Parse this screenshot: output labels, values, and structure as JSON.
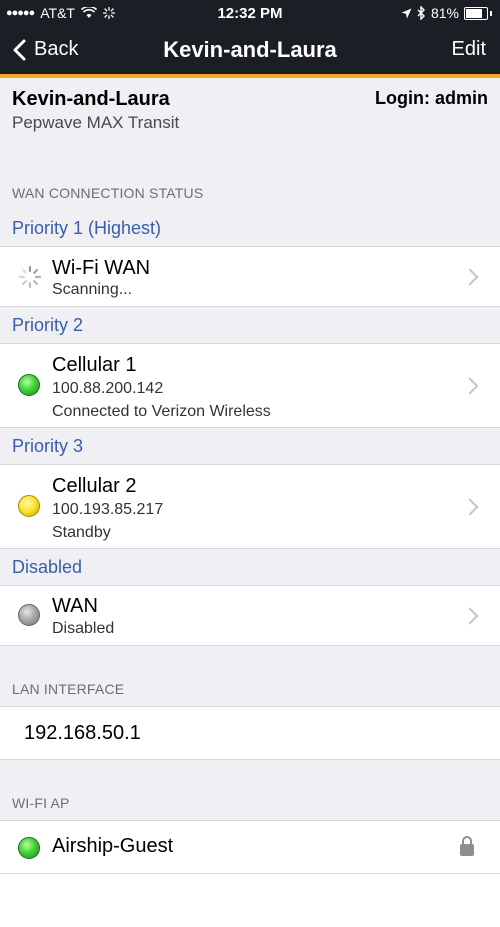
{
  "status_bar": {
    "carrier": "AT&T",
    "time": "12:32 PM",
    "battery": "81%",
    "battery_level": 0.81
  },
  "nav": {
    "back_label": "Back",
    "title": "Kevin-and-Laura",
    "edit_label": "Edit"
  },
  "device": {
    "name": "Kevin-and-Laura",
    "model": "Pepwave MAX Transit",
    "login": "Login: admin"
  },
  "wan": {
    "section_title": "WAN CONNECTION STATUS",
    "groups": [
      {
        "priority": "Priority 1 (Highest)",
        "name": "Wi-Fi WAN",
        "lines": [
          "Scanning..."
        ],
        "status_icon": "spinner-icon"
      },
      {
        "priority": "Priority 2",
        "name": "Cellular 1",
        "lines": [
          "100.88.200.142",
          "Connected to Verizon Wireless"
        ],
        "status_icon": "green-led"
      },
      {
        "priority": "Priority 3",
        "name": "Cellular 2",
        "lines": [
          "100.193.85.217",
          "Standby"
        ],
        "status_icon": "yellow-led"
      },
      {
        "priority": "Disabled",
        "name": "WAN",
        "lines": [
          "Disabled"
        ],
        "status_icon": "gray-led"
      }
    ]
  },
  "lan": {
    "section_title": "LAN INTERFACE",
    "ip": "192.168.50.1"
  },
  "wifi_ap": {
    "section_title": "WI-FI AP",
    "networks": [
      {
        "name": "Airship-Guest",
        "status_icon": "green-led",
        "secured_icon": "lock-icon"
      }
    ]
  },
  "colors": {
    "accent": "#f5a623",
    "nav_background": "#1b1e24",
    "priority_text": "#3a5ea8",
    "background": "#efeff4"
  }
}
